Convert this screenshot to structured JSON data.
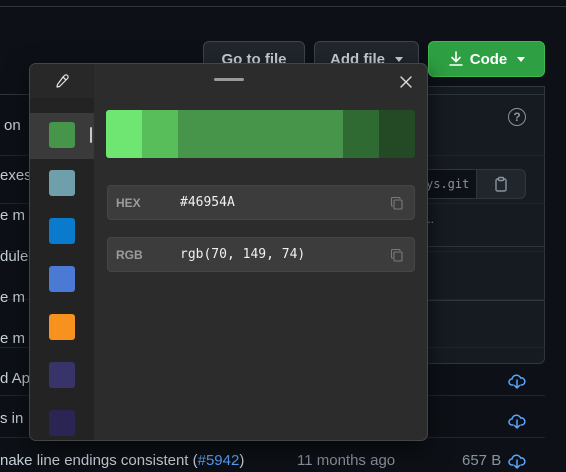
{
  "background_page": {
    "buttons": {
      "goto_file": "Go to file",
      "add_file": "Add file",
      "code": "Code"
    },
    "dropdown": {
      "help_glyph": "?",
      "clone_url_fragment": "ys.git",
      "ellipsis": "..."
    },
    "file_rows": [
      {
        "text": "on"
      },
      {
        "text": "exes"
      },
      {
        "text": "e m"
      },
      {
        "text": "dule"
      },
      {
        "text": "e m"
      },
      {
        "text": "e m"
      },
      {
        "text": "d Ap"
      },
      {
        "text": "s in"
      }
    ],
    "last_row": {
      "message_prefix": "nake line endings consistent (",
      "pr_link": "#5942",
      "message_suffix": ")",
      "age": "11 months ago",
      "size": "657 B"
    },
    "colors": {
      "page_bg": "#0d1117",
      "code_button": "#2ea043",
      "link": "#58a6ff"
    }
  },
  "color_picker": {
    "eyedropper_icon": "eyedropper-icon",
    "close_icon": "close-icon",
    "history": [
      {
        "color": "#46954A",
        "selected": true
      },
      {
        "color": "#6E9FAB",
        "selected": false
      },
      {
        "color": "#0A7BCC",
        "selected": false
      },
      {
        "color": "#4A7AD3",
        "selected": false
      },
      {
        "color": "#F7921F",
        "selected": false
      },
      {
        "color": "#383369",
        "selected": false
      },
      {
        "color": "#2A2552",
        "selected": false
      }
    ],
    "shades": [
      "#6EE671",
      "#57BE5A",
      "#46954A",
      "#46954A",
      "#306A33",
      "#244A25"
    ],
    "hex": {
      "label": "HEX",
      "value": "#46954A"
    },
    "rgb": {
      "label": "RGB",
      "value": "rgb(70, 149, 74)"
    }
  }
}
